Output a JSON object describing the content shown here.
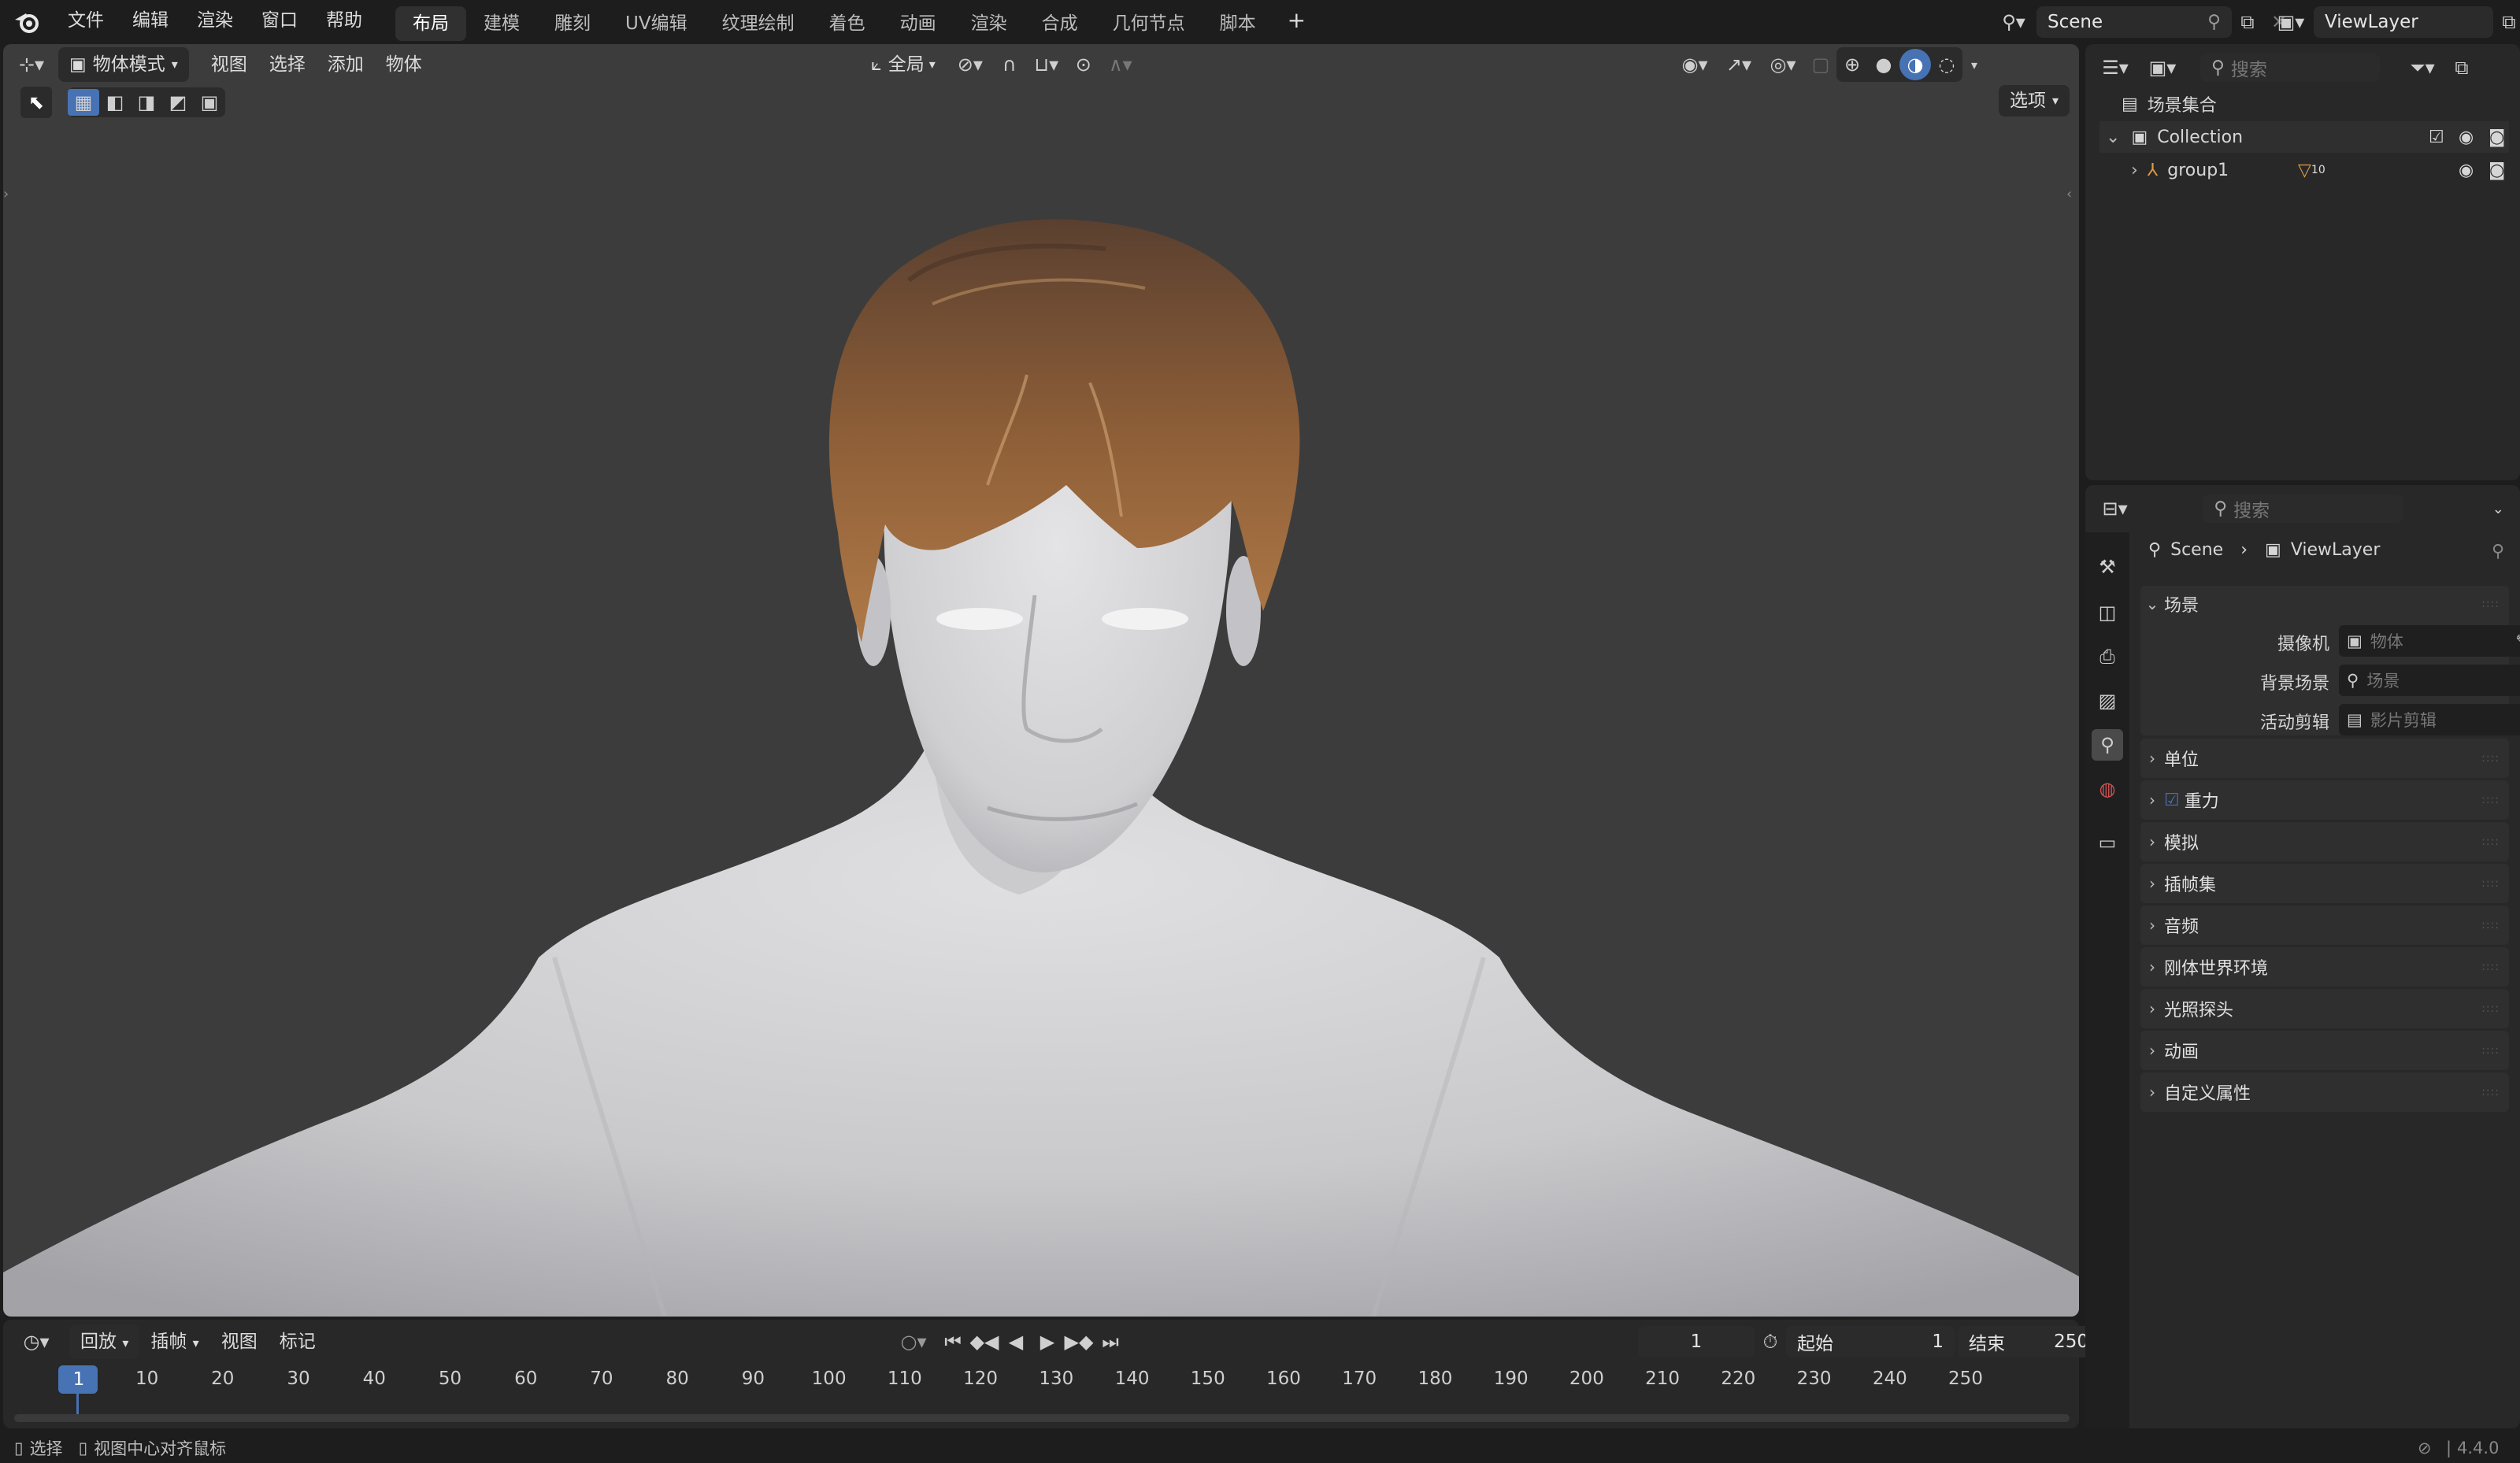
{
  "menu": {
    "file": "文件",
    "edit": "编辑",
    "render": "渲染",
    "window": "窗口",
    "help": "帮助"
  },
  "workspaces": [
    {
      "label": "布局",
      "active": true
    },
    {
      "label": "建模",
      "active": false
    },
    {
      "label": "雕刻",
      "active": false
    },
    {
      "label": "UV编辑",
      "active": false
    },
    {
      "label": "纹理绘制",
      "active": false
    },
    {
      "label": "着色",
      "active": false
    },
    {
      "label": "动画",
      "active": false
    },
    {
      "label": "渲染",
      "active": false
    },
    {
      "label": "合成",
      "active": false
    },
    {
      "label": "几何节点",
      "active": false
    },
    {
      "label": "脚本",
      "active": false
    }
  ],
  "add_workspace": "+",
  "scene_field": "Scene",
  "viewlayer_field": "ViewLayer",
  "viewport": {
    "mode": "物体模式",
    "menus": [
      "视图",
      "选择",
      "添加",
      "物体"
    ],
    "transform_orientation": "全局",
    "options_label": "选项"
  },
  "timeline": {
    "menus": [
      "回放",
      "插帧",
      "视图",
      "标记"
    ],
    "current_frame": "1",
    "start_label": "起始",
    "start_value": "1",
    "end_label": "结束",
    "end_value": "250",
    "ticks": [
      "1",
      "10",
      "20",
      "30",
      "40",
      "50",
      "60",
      "70",
      "80",
      "90",
      "100",
      "110",
      "120",
      "130",
      "140",
      "150",
      "160",
      "170",
      "180",
      "190",
      "200",
      "210",
      "220",
      "230",
      "240",
      "250"
    ]
  },
  "statusbar": {
    "select": "选择",
    "center": "视图中心对齐鼠标",
    "version": "4.4.0"
  },
  "outliner": {
    "search_placeholder": "搜索",
    "scene_collection": "场景集合",
    "collection": "Collection",
    "group": "group1",
    "group_badge": "10"
  },
  "properties": {
    "search_placeholder": "搜索",
    "breadcrumb_scene": "Scene",
    "breadcrumb_viewlayer": "ViewLayer",
    "scene_panel": "场景",
    "camera_label": "摄像机",
    "camera_placeholder": "物体",
    "background_label": "背景场景",
    "background_placeholder": "场景",
    "clip_label": "活动剪辑",
    "clip_placeholder": "影片剪辑",
    "panels": [
      "单位",
      "重力",
      "模拟",
      "插帧集",
      "音频",
      "刚体世界环境",
      "光照探头",
      "动画",
      "自定义属性"
    ]
  },
  "colors": {
    "accent": "#4772b3",
    "viewport_bg": "#3c3c3c",
    "header_bg": "#1d1d1d",
    "panel_bg": "#282828",
    "hair": "#8a5a33",
    "skin": "#d9d9dc"
  }
}
